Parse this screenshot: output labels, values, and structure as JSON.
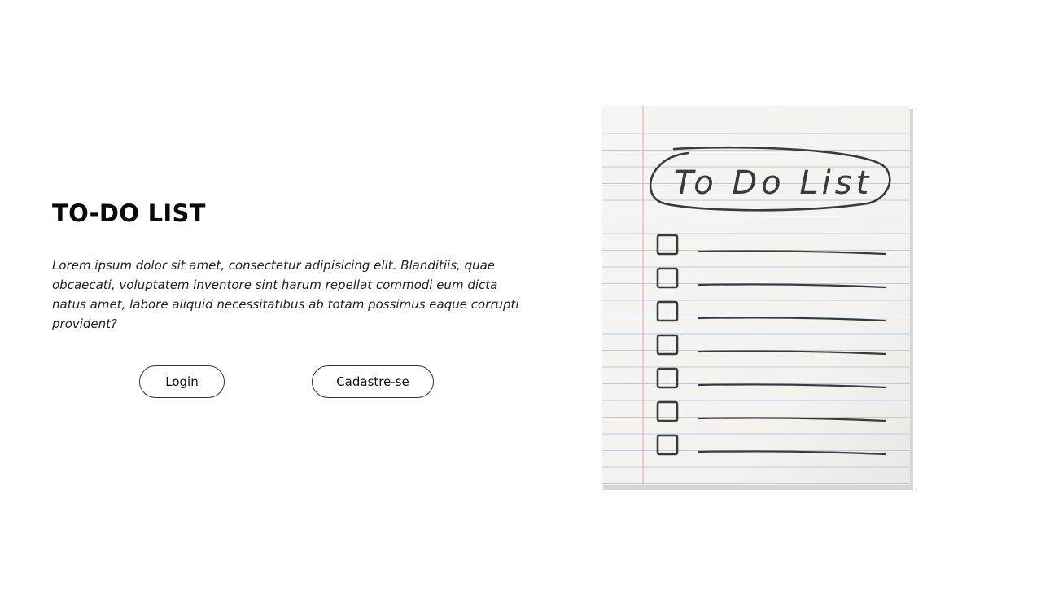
{
  "hero": {
    "title": "TO-DO LIST",
    "description": "Lorem ipsum dolor sit amet, consectetur adipisicing elit. Blanditiis, quae obcaecati, voluptatem inventore sint harum repellat commodi eum dicta natus amet, labore aliquid necessitatibus ab totam possimus eaque corrupti provident?"
  },
  "buttons": {
    "login_label": "Login",
    "signup_label": "Cadastre-se"
  },
  "illustration": {
    "heading": "To Do List",
    "checkbox_count": 7,
    "paper_color": "#f5f4f1",
    "rule_color": "#b9cbe6",
    "margin_color": "#e8a3a3",
    "ink_color": "#3a3a3a"
  }
}
